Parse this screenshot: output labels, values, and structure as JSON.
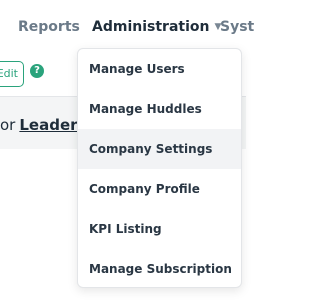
{
  "nav": {
    "reports": "Reports",
    "administration": "Administration",
    "system_partial": "Syst"
  },
  "toolbar": {
    "edit_label": "Edit",
    "help_icon": "question-circle-icon"
  },
  "banner": {
    "prefix": "or",
    "link": "Leaders"
  },
  "menu": {
    "active_index": 2,
    "items": [
      {
        "label": "Manage Users"
      },
      {
        "label": "Manage Huddles"
      },
      {
        "label": "Company Settings"
      },
      {
        "label": "Company Profile"
      },
      {
        "label": "KPI Listing"
      },
      {
        "label": "Manage Subscription"
      }
    ]
  },
  "colors": {
    "accent": "#2aa37c",
    "text_dark": "#1f2d3a",
    "text_muted": "#6b7a88",
    "menu_hover": "#f2f3f5"
  }
}
